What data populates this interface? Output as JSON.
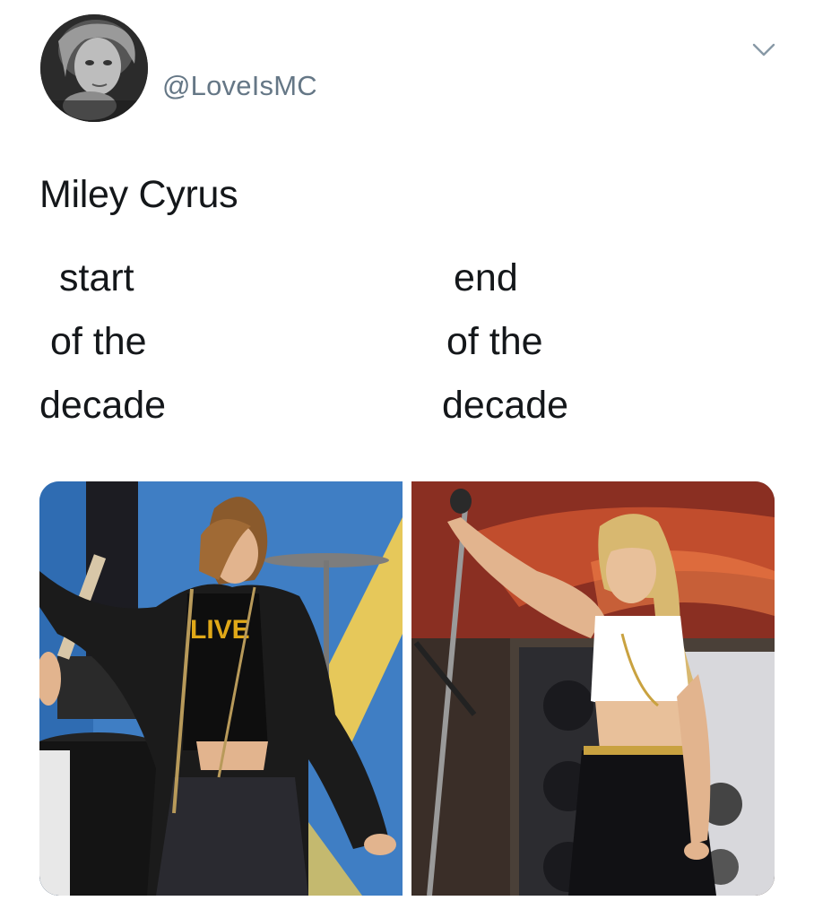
{
  "tweet": {
    "handle": "@LoveIsMC",
    "text": "Miley Cyrus",
    "caption_left": [
      "start",
      "of the",
      "decade"
    ],
    "caption_right": [
      "end",
      "of the",
      "decade"
    ]
  },
  "icons": {
    "avatar": "profile-avatar",
    "menu": "chevron-down-icon"
  },
  "colors": {
    "text": "#14171a",
    "handle": "#657786",
    "chevron": "#8899a6"
  }
}
